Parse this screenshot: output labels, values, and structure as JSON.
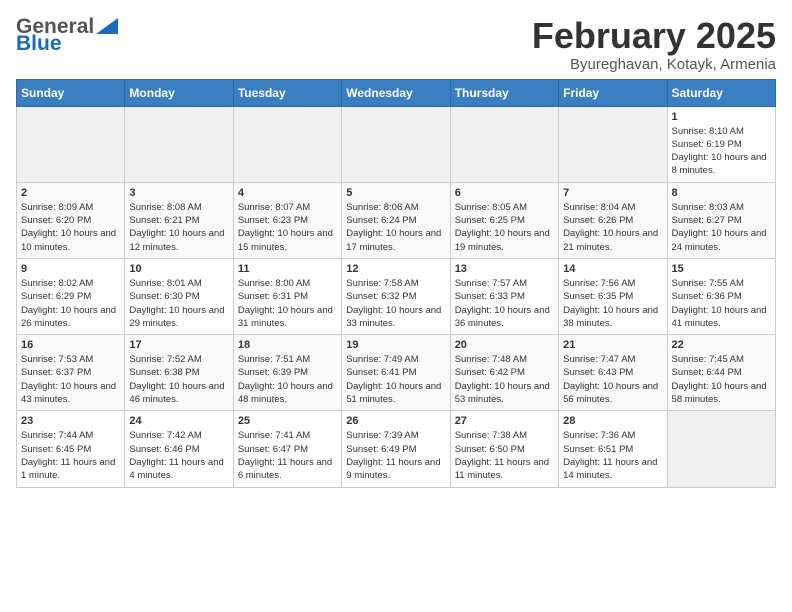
{
  "header": {
    "logo_general": "General",
    "logo_blue": "Blue",
    "month_title": "February 2025",
    "subtitle": "Byureghavan, Kotayk, Armenia"
  },
  "weekdays": [
    "Sunday",
    "Monday",
    "Tuesday",
    "Wednesday",
    "Thursday",
    "Friday",
    "Saturday"
  ],
  "weeks": [
    [
      {
        "day": "",
        "info": ""
      },
      {
        "day": "",
        "info": ""
      },
      {
        "day": "",
        "info": ""
      },
      {
        "day": "",
        "info": ""
      },
      {
        "day": "",
        "info": ""
      },
      {
        "day": "",
        "info": ""
      },
      {
        "day": "1",
        "info": "Sunrise: 8:10 AM\nSunset: 6:19 PM\nDaylight: 10 hours and 8 minutes."
      }
    ],
    [
      {
        "day": "2",
        "info": "Sunrise: 8:09 AM\nSunset: 6:20 PM\nDaylight: 10 hours and 10 minutes."
      },
      {
        "day": "3",
        "info": "Sunrise: 8:08 AM\nSunset: 6:21 PM\nDaylight: 10 hours and 12 minutes."
      },
      {
        "day": "4",
        "info": "Sunrise: 8:07 AM\nSunset: 6:23 PM\nDaylight: 10 hours and 15 minutes."
      },
      {
        "day": "5",
        "info": "Sunrise: 8:06 AM\nSunset: 6:24 PM\nDaylight: 10 hours and 17 minutes."
      },
      {
        "day": "6",
        "info": "Sunrise: 8:05 AM\nSunset: 6:25 PM\nDaylight: 10 hours and 19 minutes."
      },
      {
        "day": "7",
        "info": "Sunrise: 8:04 AM\nSunset: 6:26 PM\nDaylight: 10 hours and 21 minutes."
      },
      {
        "day": "8",
        "info": "Sunrise: 8:03 AM\nSunset: 6:27 PM\nDaylight: 10 hours and 24 minutes."
      }
    ],
    [
      {
        "day": "9",
        "info": "Sunrise: 8:02 AM\nSunset: 6:29 PM\nDaylight: 10 hours and 26 minutes."
      },
      {
        "day": "10",
        "info": "Sunrise: 8:01 AM\nSunset: 6:30 PM\nDaylight: 10 hours and 29 minutes."
      },
      {
        "day": "11",
        "info": "Sunrise: 8:00 AM\nSunset: 6:31 PM\nDaylight: 10 hours and 31 minutes."
      },
      {
        "day": "12",
        "info": "Sunrise: 7:58 AM\nSunset: 6:32 PM\nDaylight: 10 hours and 33 minutes."
      },
      {
        "day": "13",
        "info": "Sunrise: 7:57 AM\nSunset: 6:33 PM\nDaylight: 10 hours and 36 minutes."
      },
      {
        "day": "14",
        "info": "Sunrise: 7:56 AM\nSunset: 6:35 PM\nDaylight: 10 hours and 38 minutes."
      },
      {
        "day": "15",
        "info": "Sunrise: 7:55 AM\nSunset: 6:36 PM\nDaylight: 10 hours and 41 minutes."
      }
    ],
    [
      {
        "day": "16",
        "info": "Sunrise: 7:53 AM\nSunset: 6:37 PM\nDaylight: 10 hours and 43 minutes."
      },
      {
        "day": "17",
        "info": "Sunrise: 7:52 AM\nSunset: 6:38 PM\nDaylight: 10 hours and 46 minutes."
      },
      {
        "day": "18",
        "info": "Sunrise: 7:51 AM\nSunset: 6:39 PM\nDaylight: 10 hours and 48 minutes."
      },
      {
        "day": "19",
        "info": "Sunrise: 7:49 AM\nSunset: 6:41 PM\nDaylight: 10 hours and 51 minutes."
      },
      {
        "day": "20",
        "info": "Sunrise: 7:48 AM\nSunset: 6:42 PM\nDaylight: 10 hours and 53 minutes."
      },
      {
        "day": "21",
        "info": "Sunrise: 7:47 AM\nSunset: 6:43 PM\nDaylight: 10 hours and 56 minutes."
      },
      {
        "day": "22",
        "info": "Sunrise: 7:45 AM\nSunset: 6:44 PM\nDaylight: 10 hours and 58 minutes."
      }
    ],
    [
      {
        "day": "23",
        "info": "Sunrise: 7:44 AM\nSunset: 6:45 PM\nDaylight: 11 hours and 1 minute."
      },
      {
        "day": "24",
        "info": "Sunrise: 7:42 AM\nSunset: 6:46 PM\nDaylight: 11 hours and 4 minutes."
      },
      {
        "day": "25",
        "info": "Sunrise: 7:41 AM\nSunset: 6:47 PM\nDaylight: 11 hours and 6 minutes."
      },
      {
        "day": "26",
        "info": "Sunrise: 7:39 AM\nSunset: 6:49 PM\nDaylight: 11 hours and 9 minutes."
      },
      {
        "day": "27",
        "info": "Sunrise: 7:38 AM\nSunset: 6:50 PM\nDaylight: 11 hours and 11 minutes."
      },
      {
        "day": "28",
        "info": "Sunrise: 7:36 AM\nSunset: 6:51 PM\nDaylight: 11 hours and 14 minutes."
      },
      {
        "day": "",
        "info": ""
      }
    ]
  ]
}
